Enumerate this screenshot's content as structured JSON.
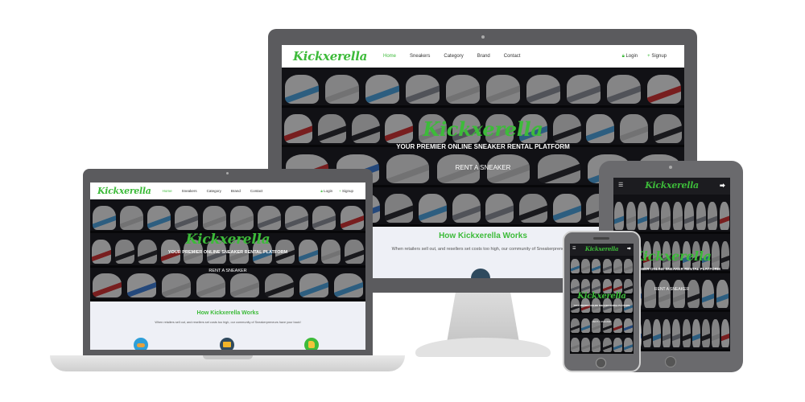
{
  "site": {
    "brand": "Kickxerella",
    "nav": {
      "home": "Home",
      "sneakers": "Sneakers",
      "category": "Category",
      "brand": "Brand",
      "contact": "Contact"
    },
    "auth": {
      "login": "Login",
      "signup": "Signup",
      "login_icon": "lock-icon",
      "signup_icon": "plus-icon"
    },
    "hero": {
      "tagline": "YOUR PREMIER ONLINE SNEAKER RENTAL PLATFORM",
      "cta": "RENT A SNEAKER"
    },
    "how": {
      "title": "How Kickxerella Works",
      "text": "When retailers sell out, and resellers set costs too high, our community of Sneakerpreneurs have your back!",
      "text_desktop_visible": "When retailers sell out, and resellers set costs too high, our community of Sneakerpreneurs h",
      "steps_icons": [
        "shoe-icon",
        "money-icon",
        "thumbs-up-icon"
      ]
    },
    "mobile": {
      "menu_icon": "hamburger-icon",
      "share_icon": "share-icon",
      "tagline_tablet_visible": "OUR PREMIER ONLINE SNEAKER RENTAL PLATFORM"
    }
  },
  "colors": {
    "accent": "#3dbb3a",
    "device_frame": "#5b5b5e",
    "device_frame_light": "#d8d8d8",
    "dark_nav": "#1c1c20"
  }
}
